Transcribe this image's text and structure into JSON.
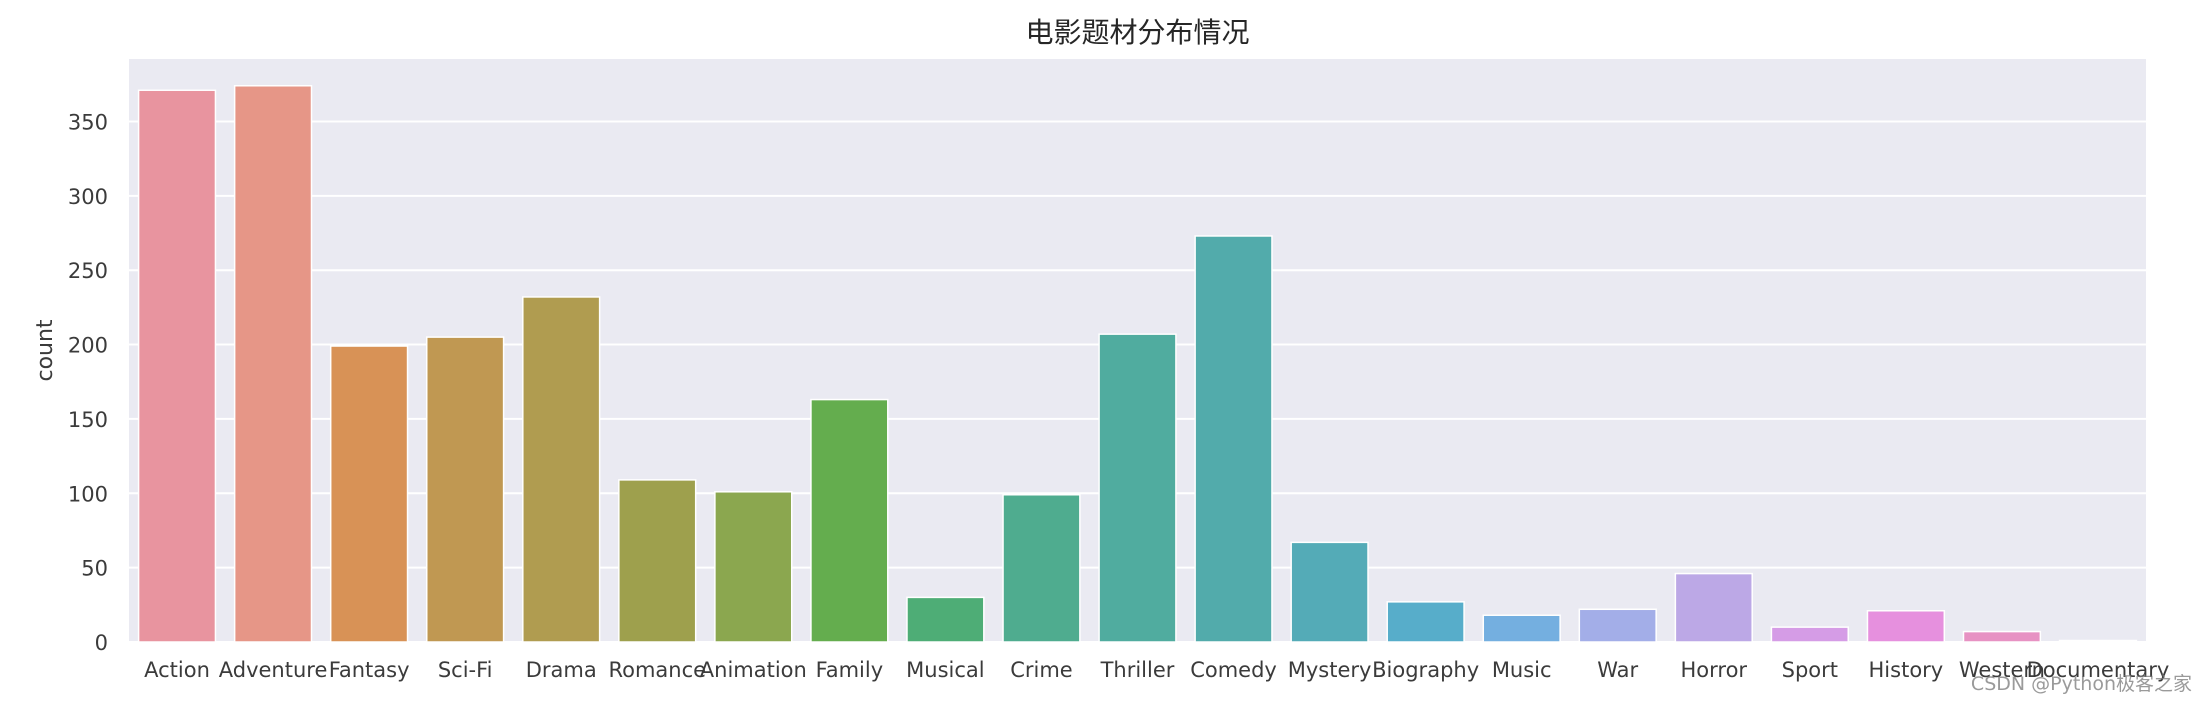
{
  "chart_data": {
    "type": "bar",
    "title": "电影题材分布情况",
    "xlabel": "",
    "ylabel": "count",
    "ylim": [
      0,
      392
    ],
    "yticks": [
      0,
      50,
      100,
      150,
      200,
      250,
      300,
      350
    ],
    "grid": true,
    "legend": "none",
    "categories": [
      "Action",
      "Adventure",
      "Fantasy",
      "Sci-Fi",
      "Drama",
      "Romance",
      "Animation",
      "Family",
      "Musical",
      "Crime",
      "Thriller",
      "Comedy",
      "Mystery",
      "Biography",
      "Music",
      "War",
      "Horror",
      "Sport",
      "History",
      "Western",
      "Documentary"
    ],
    "values": [
      371,
      374,
      199,
      205,
      232,
      109,
      101,
      163,
      30,
      99,
      207,
      273,
      67,
      27,
      18,
      22,
      46,
      10,
      21,
      7,
      1
    ],
    "colors": [
      "#e8949f",
      "#e69687",
      "#d89256",
      "#c09852",
      "#b09c50",
      "#9ea04d",
      "#8ba74f",
      "#64ad4e",
      "#4ead76",
      "#4fac8f",
      "#50ac9f",
      "#52abab",
      "#54abb7",
      "#57adca",
      "#74afe0",
      "#a3aee8",
      "#bca8e6",
      "#d59ce6",
      "#e690de",
      "#e792c3",
      "#e896b0"
    ],
    "plot_background": "#eaeaf2",
    "grid_color": "#ffffff"
  },
  "watermark": "CSDN @Python极客之家"
}
